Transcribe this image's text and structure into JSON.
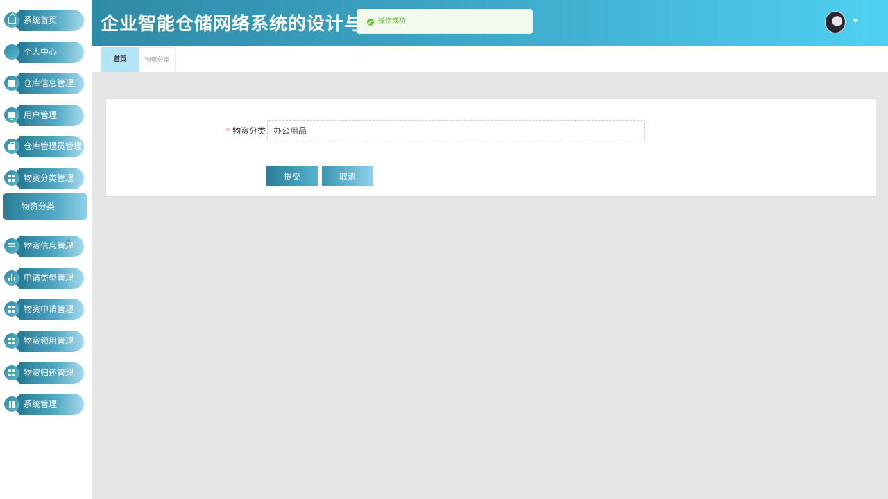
{
  "app": {
    "title": "企业智能仓储网络系统的设计与仿真",
    "brand_gradient": [
      "#2f8aa6",
      "#4fd0f2"
    ]
  },
  "sidebar": {
    "items": [
      {
        "label": "系统首页",
        "icon": "home-icon"
      },
      {
        "label": "个人中心",
        "icon": "card-icon"
      },
      {
        "label": "仓库信息管理",
        "icon": "box-icon"
      },
      {
        "label": "用户管理",
        "icon": "monitor-icon"
      },
      {
        "label": "仓库管理员管理",
        "icon": "bag-icon"
      },
      {
        "label": "物资分类管理",
        "icon": "grid-icon"
      },
      {
        "label": "物资信息管理",
        "icon": "sliders-icon"
      },
      {
        "label": "申请类型管理",
        "icon": "bar-chart-icon"
      },
      {
        "label": "物资申请管理",
        "icon": "grid-icon"
      },
      {
        "label": "物资领用管理",
        "icon": "grid-icon"
      },
      {
        "label": "物资归还管理",
        "icon": "grid-icon"
      },
      {
        "label": "系统管理",
        "icon": "book-icon"
      }
    ],
    "submenu": {
      "label": "物资分类"
    }
  },
  "toast": {
    "text": "操作成功",
    "color": "#67c23a",
    "icon": "check-circle-icon"
  },
  "header": {
    "avatar": "user-avatar",
    "dropdown_icon": "caret-down-icon"
  },
  "tabs": [
    {
      "label": "首页",
      "active": true
    },
    {
      "label": "物资分类",
      "active": false
    }
  ],
  "form": {
    "required_mark": "*",
    "category_label": "物资分类",
    "category_value": "办公用品",
    "submit_label": "提交",
    "cancel_label": "取消"
  }
}
